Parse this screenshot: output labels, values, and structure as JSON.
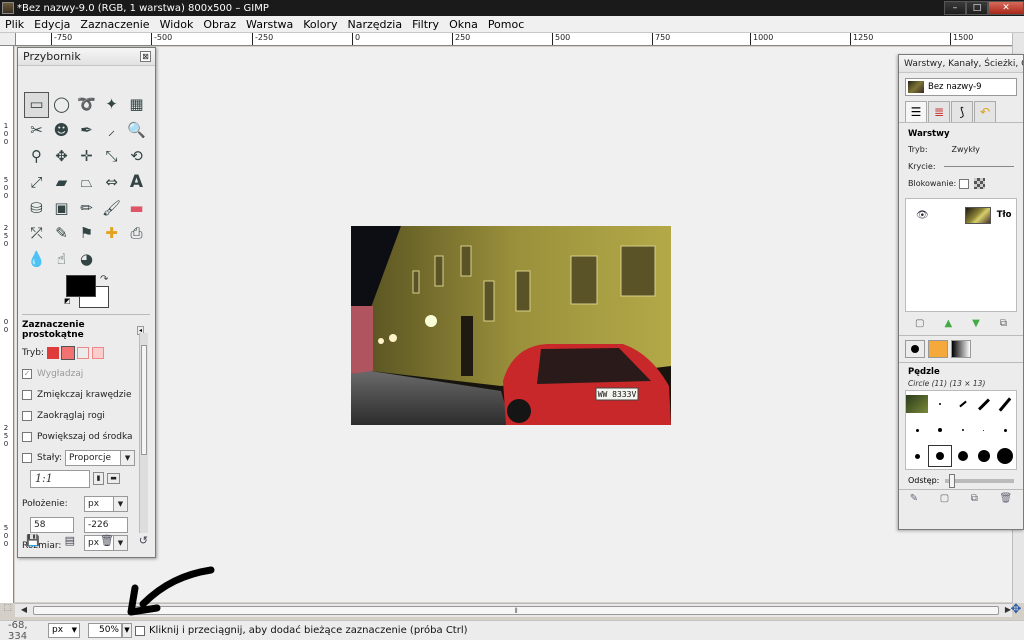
{
  "window": {
    "title": "*Bez nazwy-9.0 (RGB, 1 warstwa) 800x500 – GIMP",
    "minimize": "–",
    "maximize": "□",
    "close": "✕"
  },
  "menu": [
    "Plik",
    "Edycja",
    "Zaznaczenie",
    "Widok",
    "Obraz",
    "Warstwa",
    "Kolory",
    "Narzędzia",
    "Filtry",
    "Okna",
    "Pomoc"
  ],
  "ruler": {
    "h_labels": [
      "-750",
      "-500",
      "-250",
      "0",
      "250",
      "500",
      "750",
      "1000",
      "1250",
      "1500"
    ],
    "v_labels": [
      "1",
      "0",
      "0",
      "5",
      "0",
      "0",
      "2",
      "5",
      "0",
      "0",
      "0",
      "2",
      "5",
      "0",
      "5",
      "0",
      "0"
    ]
  },
  "toolbox": {
    "title": "Przybornik",
    "close": "⊠",
    "tool_icons": [
      "rect-select-icon",
      "ellipse-select-icon",
      "free-select-icon",
      "fuzzy-select-icon",
      "color-select-icon",
      "scissors-icon",
      "foreground-select-icon",
      "paths-icon",
      "color-picker-icon",
      "zoom-icon",
      "measure-icon",
      "move-icon",
      "align-icon",
      "crop-icon",
      "rotate-icon",
      "scale-icon",
      "shear-icon",
      "perspective-icon",
      "flip-icon",
      "text-icon",
      "bucket-fill-icon",
      "blend-icon",
      "pencil-icon",
      "paintbrush-icon",
      "eraser-icon",
      "airbrush-icon",
      "ink-icon",
      "clone-icon",
      "heal-icon",
      "perspective-clone-icon",
      "blur-icon",
      "smudge-icon",
      "dodge-burn-icon"
    ],
    "options": {
      "title": "Zaznaczenie prostokątne",
      "mode_label": "Tryb:",
      "antialias": "Wygładzaj",
      "feather": "Zmiękczaj krawędzie",
      "rounded": "Zaokrąglaj rogi",
      "expand": "Powiększaj od środka",
      "fixed": "Stały:",
      "fixed_value": "Proporcje",
      "ratio": "1:1",
      "position_label": "Położenie:",
      "position_unit": "px",
      "pos_x": "58",
      "pos_y": "-226",
      "size_label": "Rozmiar:",
      "size_unit": "px"
    }
  },
  "layers_dock": {
    "title": "Warstwy, Kanały, Ścieżki, Co",
    "image_name": "Bez nazwy-9",
    "section": "Warstwy",
    "mode_label": "Tryb:",
    "mode_value": "Zwykły",
    "opacity_label": "Krycie:",
    "lock_label": "Blokowanie:",
    "layer_name": "Tło",
    "brushes_title": "Pędzle",
    "brush_info": "Circle (11) (13 × 13)",
    "spacing_label": "Odstęp:"
  },
  "statusbar": {
    "coords": "-68, 334",
    "unit": "px",
    "zoom": "50%",
    "message": "Kliknij i przeciągnij, aby dodać bieżące zaznaczenie (próba Ctrl)"
  },
  "photo": {
    "plate": "WW 8333V"
  },
  "colors": {
    "foreground": "#000000",
    "background": "#ffffff",
    "photo_facade": "#a59b3e",
    "car": "#c8282a"
  }
}
